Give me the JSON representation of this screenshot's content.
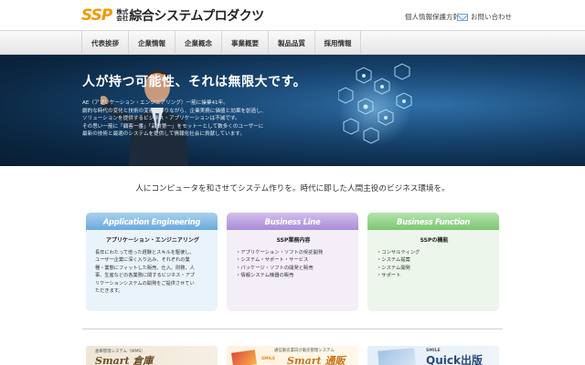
{
  "header": {
    "logo_mark": "SSP",
    "logo_kabu_top": "株式",
    "logo_kabu_bottom": "会社",
    "logo_name": "綜合システムプロダクツ",
    "privacy_link": "個人情報保護方針",
    "contact_link": "お問い合わせ"
  },
  "nav": {
    "items": [
      "代表挨拶",
      "企業情報",
      "企業概念",
      "事業概要",
      "製品品質",
      "採用情報"
    ]
  },
  "hero": {
    "title": "人が持つ可能性、それは無限大です。",
    "text": [
      "AE（アプリケーション・エンジニアリング）一筋に操業41年。",
      "劇的な時代の変化と技術の変遷がありながら、企業実務に価値と効果を創造し、",
      "ソリューションを提供するビジネス・アプリケーションは不滅です。",
      "その思い一筋に「顧客一番」「品質第一」をモットーとして数多くのユーザーに",
      "最新の技術と最適のシステムを提供して情報化社会に貢献しています。"
    ]
  },
  "tagline": "人にコンピュータを和させてシステム作りを。時代に即した人間主役のビジネス環境を。",
  "cards": [
    {
      "title": "Application Engineering",
      "subtitle": "アプリケーション・エンジニアリング",
      "paragraph": [
        "長年にわたって培った経験とスキルを駆使し、",
        "ユーザー企業に深く入り込み、それぞれの業",
        "種・業態にフィットした販売、仕入、財務、人",
        "事、生産などの各業務に関するビジネス・アプ",
        "リケーションシステムの開発をご提供させてい",
        "ただきます。"
      ]
    },
    {
      "title": "Business Line",
      "subtitle": "SSP業務内容",
      "items": [
        "・アプリケーション・ソフトの受託開発",
        "・システム・サポート・サービス",
        "・パッケージ・ソフトの開発と販売",
        "・情報システム機器の販売"
      ]
    },
    {
      "title": "Business Function",
      "subtitle": "SSPの機能",
      "items": [
        "・コンサルティング",
        "・システム提案",
        "・システム開発",
        "・サポート"
      ]
    }
  ],
  "banners": [
    {
      "small": "倉庫管理システム（WMS）",
      "big": "Smart 倉庫"
    },
    {
      "small": "通信販売業向け販売管理システム",
      "brand": "SMILE",
      "big": "Smart 通販"
    },
    {
      "brand": "SMILE",
      "big": "Quick出版"
    }
  ],
  "colors": {
    "brand_orange": "#f39800",
    "hero_blue": "#17446f",
    "card1_head": "#6aa9dc",
    "card2_head": "#a98bd6",
    "card3_head": "#7cc672"
  }
}
